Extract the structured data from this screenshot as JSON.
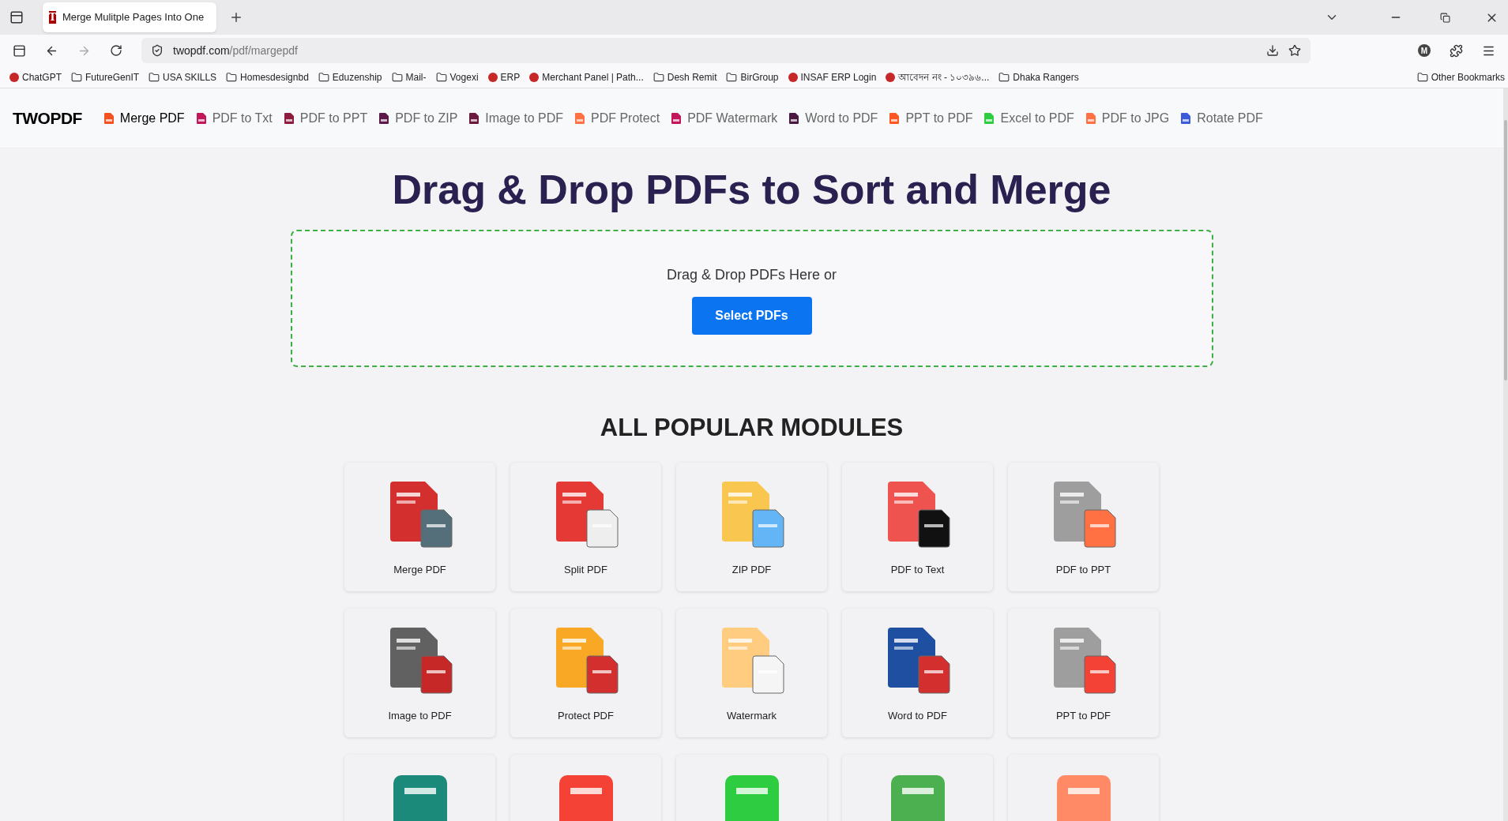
{
  "browser": {
    "tab": {
      "title": "Merge Mulitple Pages Into One",
      "favicon": "T"
    },
    "url": {
      "host": "twopdf.com",
      "path": "/pdf/margepdf"
    },
    "profile": "M",
    "bookmarks": [
      {
        "label": "ChatGPT",
        "kind": "site"
      },
      {
        "label": "FutureGenIT",
        "kind": "folder"
      },
      {
        "label": "USA SKILLS",
        "kind": "folder"
      },
      {
        "label": "Homesdesignbd",
        "kind": "folder"
      },
      {
        "label": "Eduzenship",
        "kind": "folder"
      },
      {
        "label": "Mail-",
        "kind": "folder"
      },
      {
        "label": "Vogexi",
        "kind": "folder"
      },
      {
        "label": "ERP",
        "kind": "site"
      },
      {
        "label": "Merchant Panel | Path...",
        "kind": "site"
      },
      {
        "label": "Desh Remit",
        "kind": "folder"
      },
      {
        "label": "BirGroup",
        "kind": "folder"
      },
      {
        "label": "INSAF ERP Login",
        "kind": "site"
      },
      {
        "label": "আবেদন নং - ১০৩৯৬...",
        "kind": "site"
      },
      {
        "label": "Dhaka Rangers",
        "kind": "folder"
      }
    ],
    "other_bookmarks": "Other Bookmarks"
  },
  "site": {
    "logo": "TWOPDF",
    "nav": [
      {
        "label": "Merge PDF",
        "selected": true,
        "color": "#f4511e"
      },
      {
        "label": "PDF to Txt",
        "selected": false,
        "color": "#c2185b"
      },
      {
        "label": "PDF to PPT",
        "selected": false,
        "color": "#8e1c3f"
      },
      {
        "label": "PDF to ZIP",
        "selected": false,
        "color": "#5b1a4a"
      },
      {
        "label": "Image to PDF",
        "selected": false,
        "color": "#6b1a3e"
      },
      {
        "label": "PDF Protect",
        "selected": false,
        "color": "#ff7043"
      },
      {
        "label": "PDF Watermark",
        "selected": false,
        "color": "#c2185b"
      },
      {
        "label": "Word to PDF",
        "selected": false,
        "color": "#4a1942"
      },
      {
        "label": "PPT to PDF",
        "selected": false,
        "color": "#ff5722"
      },
      {
        "label": "Excel to PDF",
        "selected": false,
        "color": "#2ecc40"
      },
      {
        "label": "PDF to JPG",
        "selected": false,
        "color": "#ff7043"
      },
      {
        "label": "Rotate PDF",
        "selected": false,
        "color": "#3b5bdb"
      }
    ],
    "heading": "Drag & Drop PDFs to Sort and Merge",
    "dropzone": {
      "text": "Drag & Drop PDFs Here or",
      "button": "Select PDFs"
    },
    "modules_heading": "ALL POPULAR MODULES",
    "modules": [
      {
        "label": "Merge PDF"
      },
      {
        "label": "Split PDF"
      },
      {
        "label": "ZIP PDF"
      },
      {
        "label": "PDF to Text"
      },
      {
        "label": "PDF to PPT"
      },
      {
        "label": "Image to PDF"
      },
      {
        "label": "Protect PDF"
      },
      {
        "label": "Watermark"
      },
      {
        "label": "Word to PDF"
      },
      {
        "label": "PPT to PDF"
      }
    ]
  }
}
